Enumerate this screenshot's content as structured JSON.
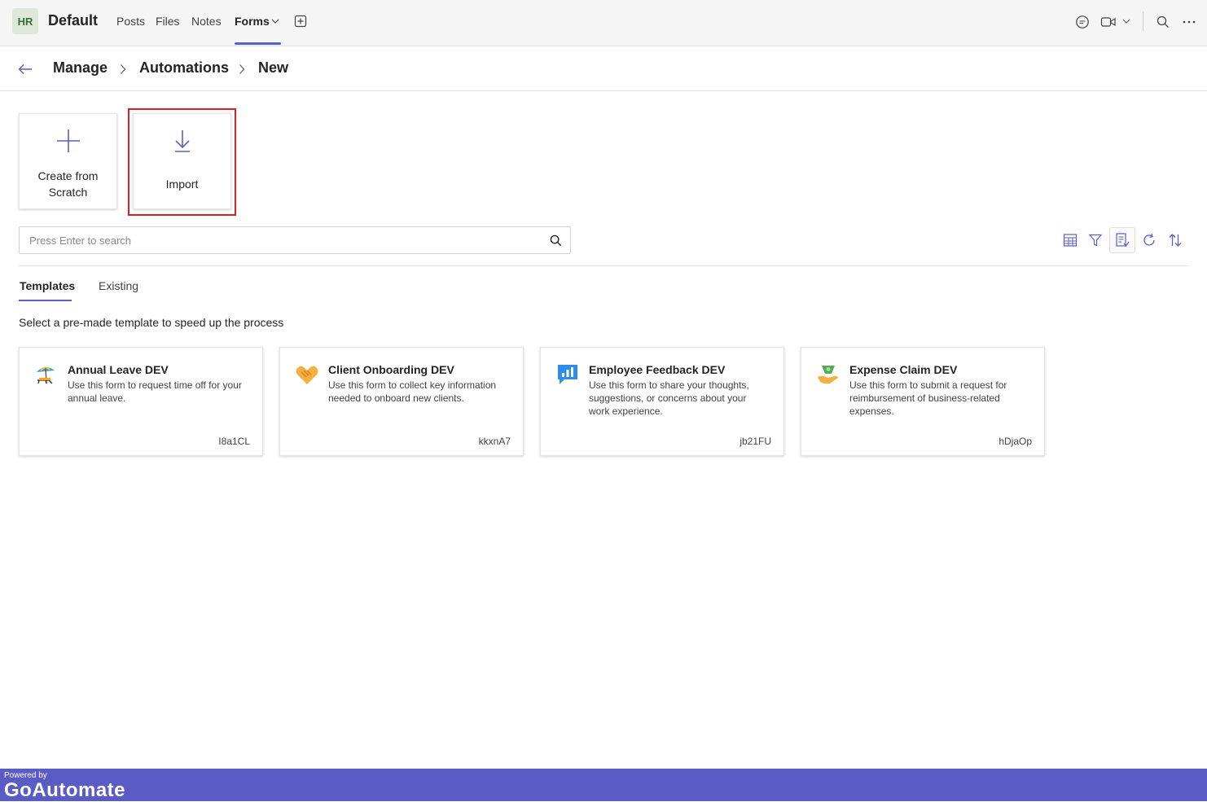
{
  "header": {
    "avatar_initials": "HR",
    "team_name": "Default",
    "tabs": [
      {
        "label": "Posts"
      },
      {
        "label": "Files"
      },
      {
        "label": "Notes"
      },
      {
        "label": "Forms"
      }
    ],
    "active_tab": "Forms",
    "icons": [
      "add-tab-icon",
      "chat-icon",
      "video-icon",
      "chevron-down-icon",
      "search-icon",
      "more-icon"
    ]
  },
  "breadcrumb": {
    "items": [
      "Manage",
      "Automations",
      "New"
    ]
  },
  "actions": {
    "create_label": "Create from Scratch",
    "import_label": "Import"
  },
  "search": {
    "placeholder": "Press Enter to search"
  },
  "toolbar_icons": [
    "table-icon",
    "filter-icon",
    "form-list-icon",
    "refresh-icon",
    "sort-icon"
  ],
  "subtabs": [
    {
      "label": "Templates"
    },
    {
      "label": "Existing"
    }
  ],
  "active_subtab": "Templates",
  "hint": "Select a pre-made template to speed up the process",
  "templates": [
    {
      "title": "Annual Leave DEV",
      "description": "Use this form to request time off for your annual leave.",
      "code": "I8a1CL",
      "icon": "beach-umbrella-icon"
    },
    {
      "title": "Client Onboarding DEV",
      "description": "Use this form to collect key information needed to onboard new clients.",
      "code": "kkxnA7",
      "icon": "handshake-icon"
    },
    {
      "title": "Employee Feedback DEV",
      "description": "Use this form to share your thoughts, suggestions, or concerns about your work experience.",
      "code": "jb21FU",
      "icon": "feedback-chart-icon"
    },
    {
      "title": "Expense Claim DEV",
      "description": "Use this form to submit a request for reimbursement of business-related expenses.",
      "code": "hDjaOp",
      "icon": "money-hand-icon"
    }
  ],
  "footer": {
    "powered_by": "Powered by",
    "brand": "GoAutomate"
  },
  "colors": {
    "accent": "#5b5fc7",
    "footer": "#5b5bc6",
    "highlight": "#d92027"
  }
}
